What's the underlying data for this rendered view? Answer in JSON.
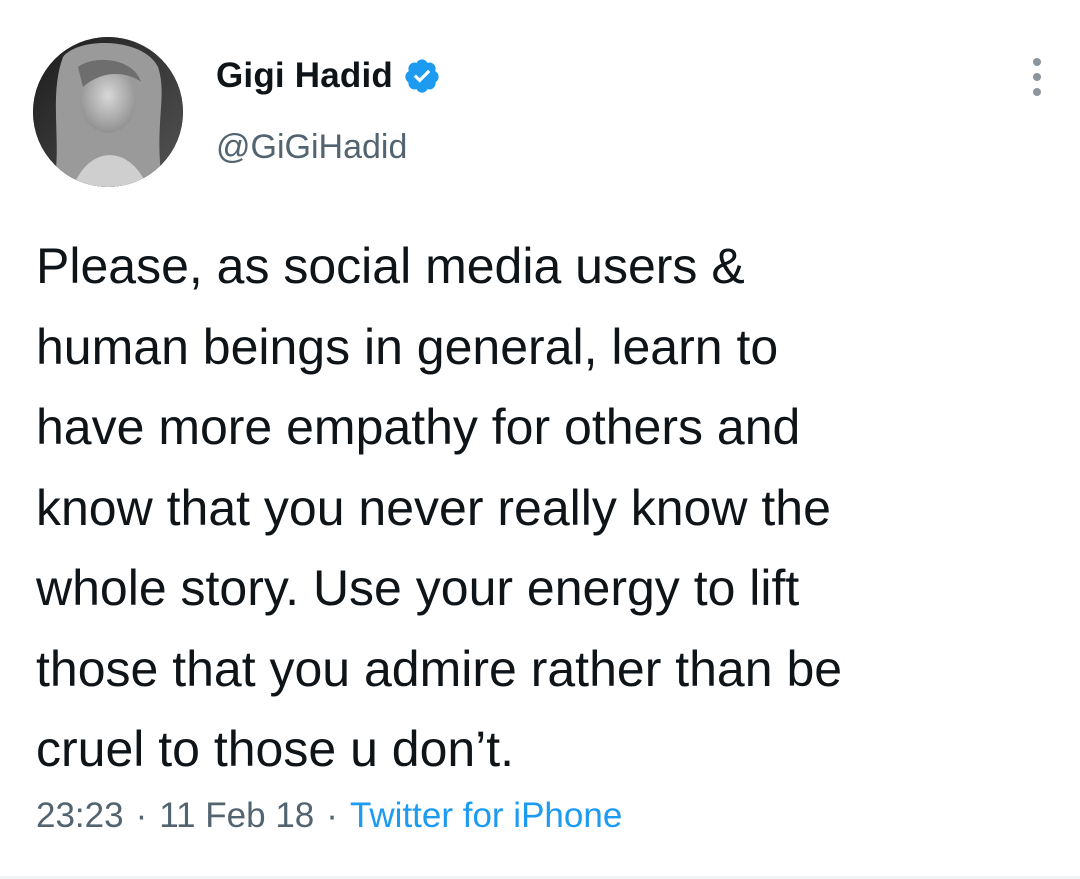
{
  "tweet": {
    "author": {
      "display_name": "Gigi Hadid",
      "handle": "@GiGiHadid",
      "verified": true,
      "avatar_icon": "profile-photo"
    },
    "text": "Please, as social media users &\nhuman beings in general, learn to\nhave more empathy for others and\nknow that you never really know the\nwhole story. Use your energy to lift\nthose that you admire rather than be\ncruel to those u don’t.",
    "time": "23:23",
    "separator": "·",
    "date": "11 Feb 18",
    "source": "Twitter for iPhone",
    "more_icon": "more-vertical-icon"
  },
  "colors": {
    "accent": "#1d9bf0",
    "secondary_text": "#536471",
    "primary_text": "#0f1419"
  }
}
